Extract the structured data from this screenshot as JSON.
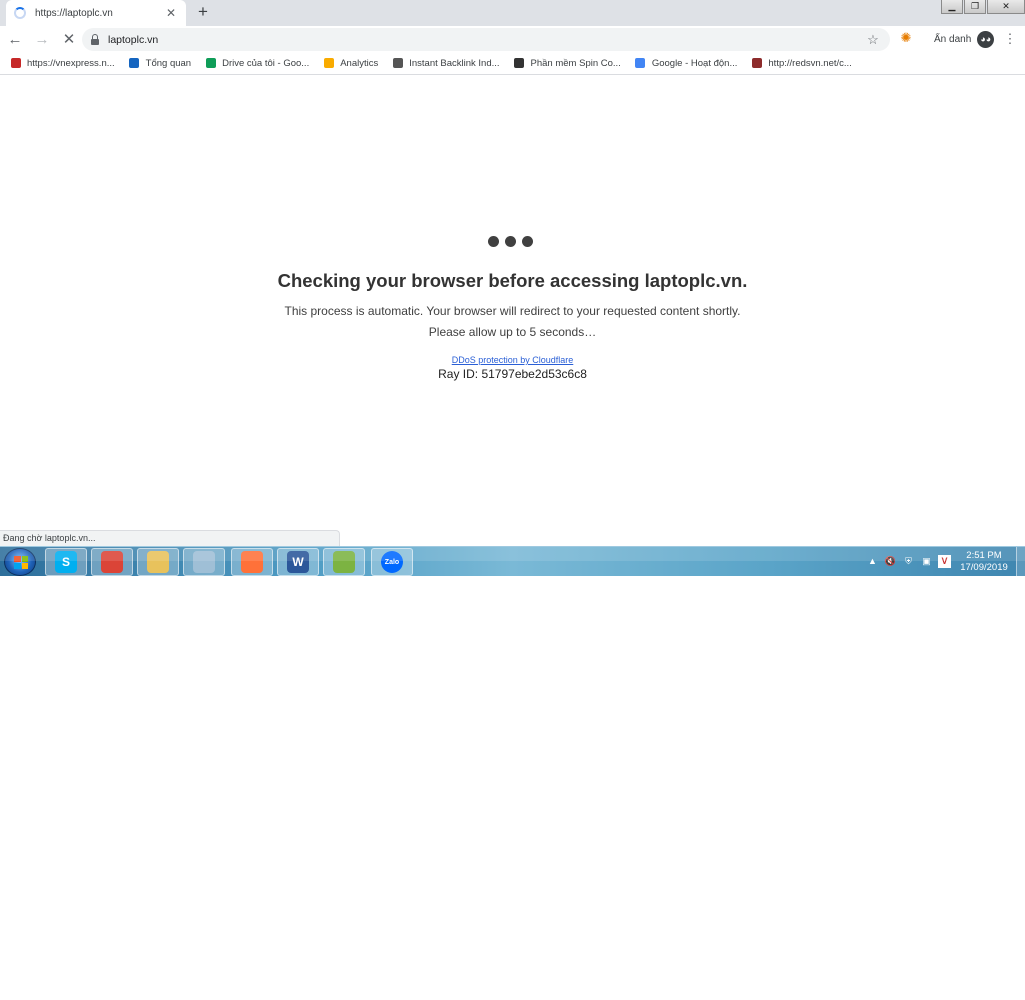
{
  "browser": {
    "tab_title": "https://laptoplc.vn",
    "url": "laptoplc.vn",
    "incognito_label": "Ẩn danh",
    "status_text": "Đang chờ laptoplc.vn..."
  },
  "bookmarks": [
    {
      "label": "https://vnexpress.n...",
      "icon": "vnexpress-icon",
      "color": "#c62828"
    },
    {
      "label": "Tổng quan",
      "icon": "overview-icon",
      "color": "#1565c0"
    },
    {
      "label": "Drive của tôi - Goo...",
      "icon": "google-drive-icon",
      "color": "#0f9d58"
    },
    {
      "label": "Analytics",
      "icon": "analytics-icon",
      "color": "#f9ab00"
    },
    {
      "label": "Instant Backlink Ind...",
      "icon": "seo-icon",
      "color": "#555555"
    },
    {
      "label": "Phần mềm Spin Co...",
      "icon": "user-silhouette-icon",
      "color": "#333333"
    },
    {
      "label": "Google - Hoạt độn...",
      "icon": "google-icon",
      "color": "#4285f4"
    },
    {
      "label": "http://redsvn.net/c...",
      "icon": "redsvn-icon",
      "color": "#8d2b2b"
    }
  ],
  "page": {
    "heading": "Checking your browser before accessing laptoplc.vn.",
    "line1": "This process is automatic. Your browser will redirect to your requested content shortly.",
    "line2": "Please allow up to 5 seconds…",
    "ddos_link": "DDoS protection by Cloudflare",
    "ray_id": "Ray ID: 51797ebe2d53c6c8"
  },
  "taskbar": {
    "apps": [
      {
        "name": "skype-icon",
        "glyph": "S",
        "color": "#00aff0"
      },
      {
        "name": "chrome-icon",
        "glyph": "",
        "color": "#db4437"
      },
      {
        "name": "file-explorer-icon",
        "glyph": "",
        "color": "#e8c25c"
      },
      {
        "name": "notebook-icon",
        "glyph": "",
        "color": "#9fbfd6"
      },
      {
        "name": "firefox-icon",
        "glyph": "",
        "color": "#ff7139"
      },
      {
        "name": "word-icon",
        "glyph": "W",
        "color": "#2b579a"
      },
      {
        "name": "task-manager-icon",
        "glyph": "",
        "color": "#7cb342"
      },
      {
        "name": "zalo-icon",
        "glyph": "Zalo",
        "color": "#0068ff"
      }
    ],
    "time": "2:51 PM",
    "date": "17/09/2019"
  },
  "colors": {
    "heading": "#333333",
    "link": "#2a5fd6",
    "tabstrip": "#dee1e6"
  }
}
